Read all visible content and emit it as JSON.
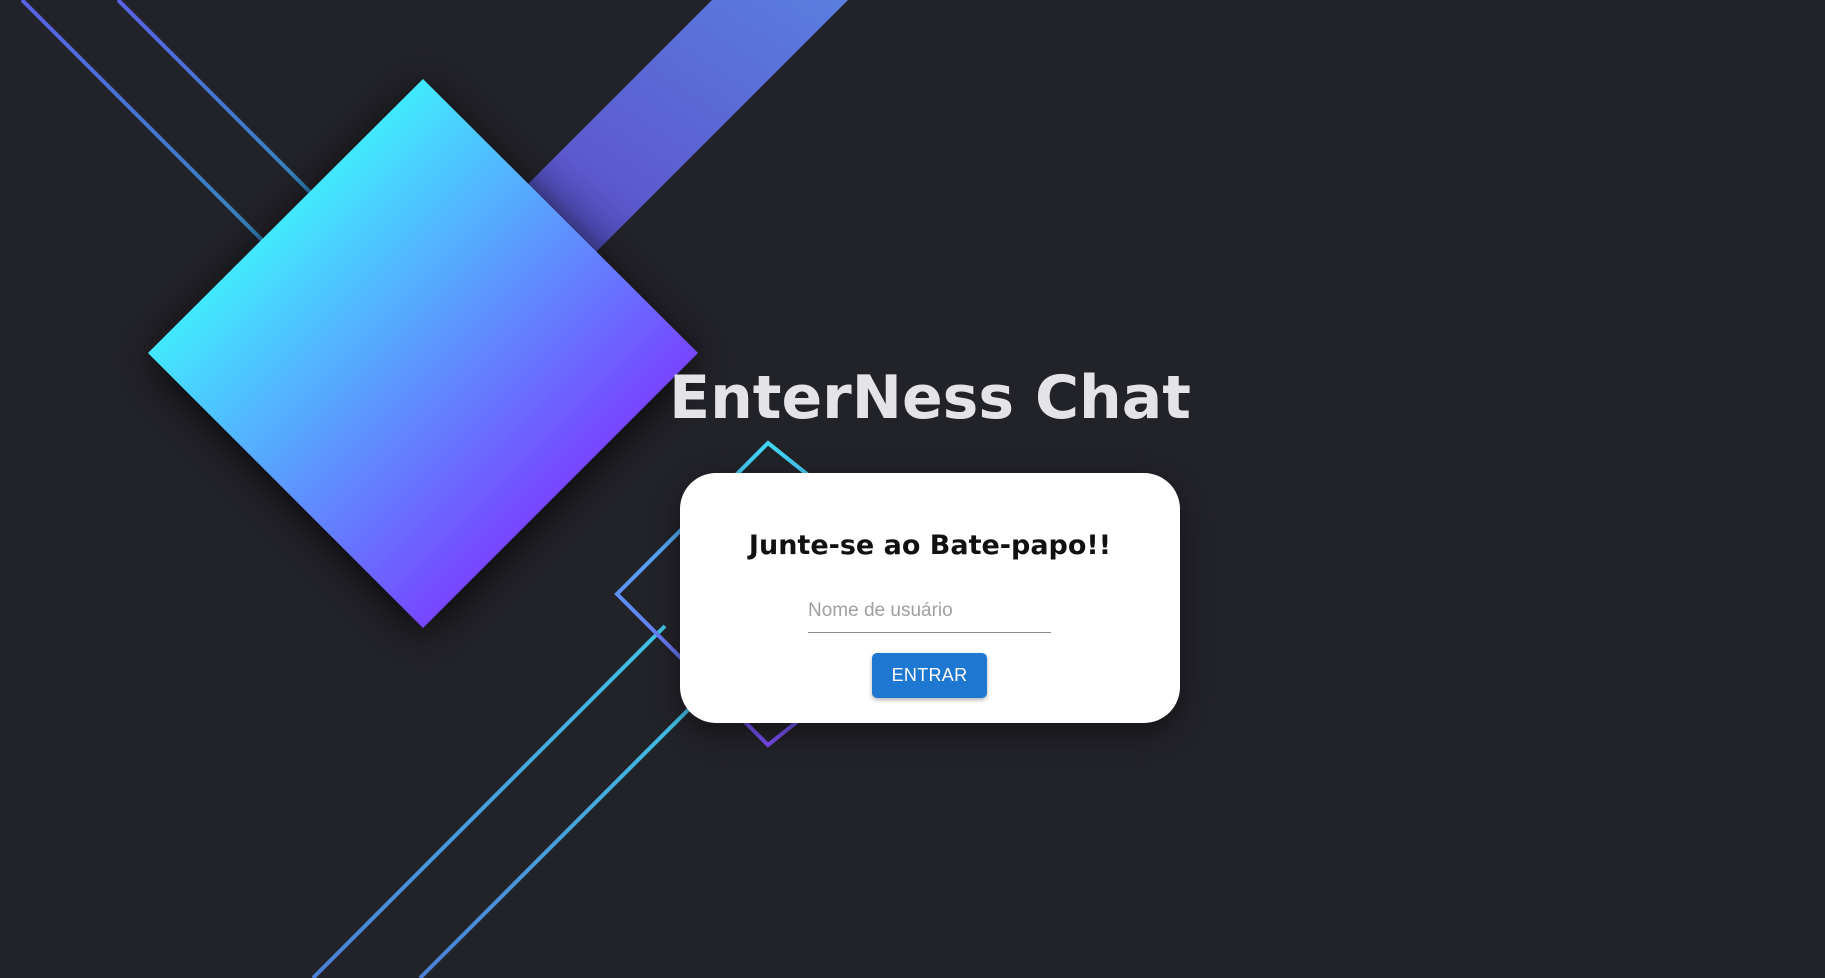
{
  "app": {
    "title": "EnterNess Chat"
  },
  "login": {
    "heading": "Junte-se ao Bate-papo!!",
    "username_placeholder": "Nome de usuário",
    "username_value": "",
    "submit_label": "ENTRAR"
  },
  "theme": {
    "background": "#222229",
    "accent_cyan": "#42e8fe",
    "accent_purple": "#7646ff",
    "button_blue": "#1e77d0",
    "card_background": "#ffffff"
  }
}
